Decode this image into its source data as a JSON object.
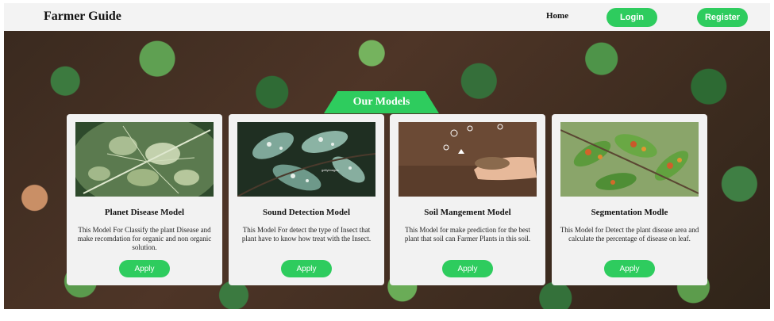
{
  "navbar": {
    "brand": "Farmer Guide",
    "home_label": "Home",
    "login_label": "Login",
    "register_label": "Register"
  },
  "section": {
    "title": "Our Models"
  },
  "cards": [
    {
      "title": "Planet Disease Model",
      "description": "This Model For Classify the plant Disease and make recomdation for organic and non organic solution.",
      "apply_label": "Apply"
    },
    {
      "title": "Sound Detection Model",
      "description": "This Model For detect the type of Insect that plant have to know how treat with the Insect.",
      "apply_label": "Apply"
    },
    {
      "title": "Soil Mangement Model",
      "description": "This Model for make prediction for the best plant that soil can Farmer Plants in this soil.",
      "apply_label": "Apply"
    },
    {
      "title": "Segmentation Modle",
      "description": "This Model for Detect the plant disease area and calculate the percentage of disease on leaf.",
      "apply_label": "Apply"
    }
  ],
  "colors": {
    "accent": "#2ecc5e",
    "navbar_bg": "#f3f3f3",
    "card_bg": "#f2f2f2"
  }
}
